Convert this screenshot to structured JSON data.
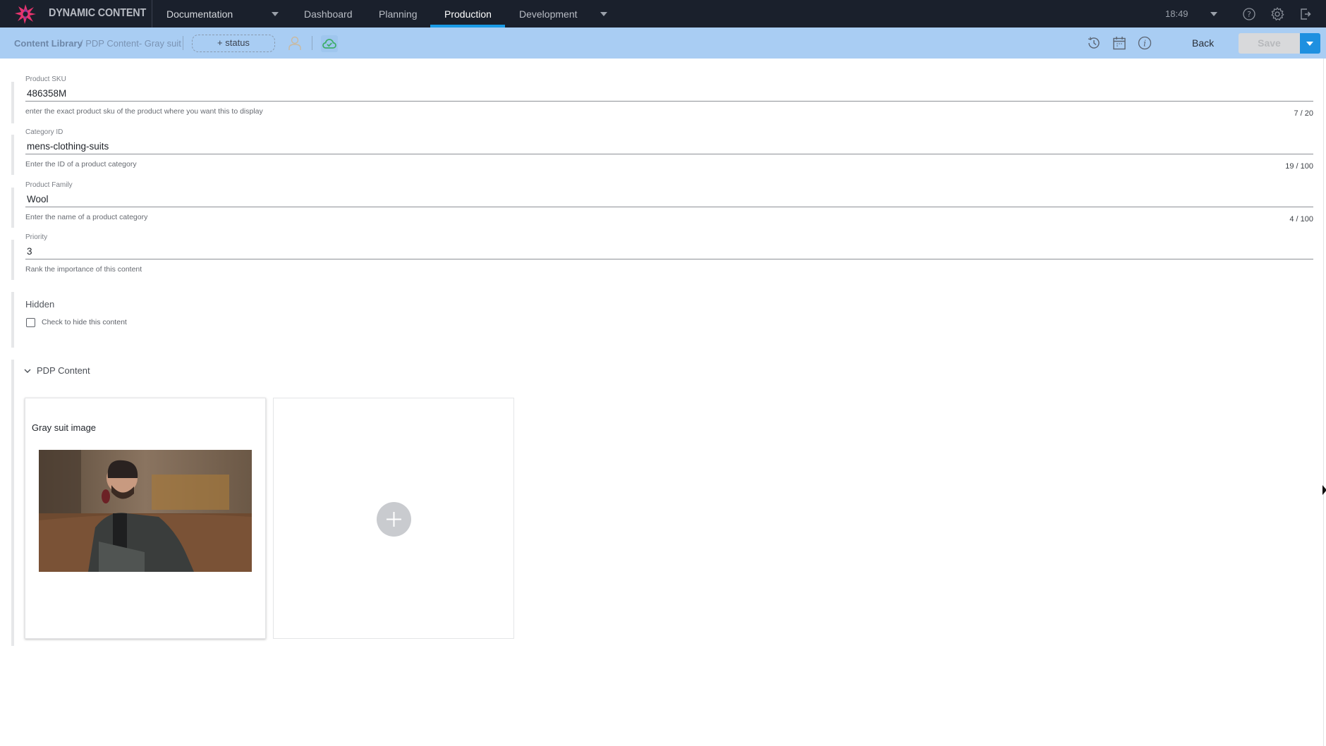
{
  "app": {
    "brand": "DYNAMIC CONTENT",
    "hub": "Documentation",
    "nav_tabs": [
      {
        "label": "Dashboard",
        "active": false
      },
      {
        "label": "Planning",
        "active": false
      },
      {
        "label": "Production",
        "active": true
      },
      {
        "label": "Development",
        "active": false
      }
    ],
    "time": "18:49",
    "accent_color": "#1a9be6"
  },
  "toolbar": {
    "breadcrumb_root": "Content Library",
    "breadcrumb_rest": "/ PDP Content- Gray suit",
    "status_button": "+ status",
    "back_label": "Back",
    "save_label": "Save"
  },
  "form": {
    "fields": [
      {
        "label": "Product SKU",
        "value": "486358M",
        "hint": "enter the exact product sku of the product where you want this to display",
        "count": "7 / 20"
      },
      {
        "label": "Category ID",
        "value": "mens-clothing-suits",
        "hint": "Enter the ID of a product category",
        "count": "19 / 100"
      },
      {
        "label": "Product Family",
        "value": "Wool",
        "hint": "Enter the name of a product category",
        "count": "4 / 100"
      },
      {
        "label": "Priority",
        "value": "3",
        "hint": "Rank the importance of this content",
        "count": ""
      }
    ],
    "hidden": {
      "title": "Hidden",
      "checkbox_label": "Check to hide this content",
      "checked": false
    },
    "pdp_section": {
      "title": "PDP Content",
      "expanded": true,
      "cards": [
        {
          "title": "Gray suit image",
          "image_alt": "Man in gray suit on leather sofa with wine glass"
        }
      ]
    }
  }
}
